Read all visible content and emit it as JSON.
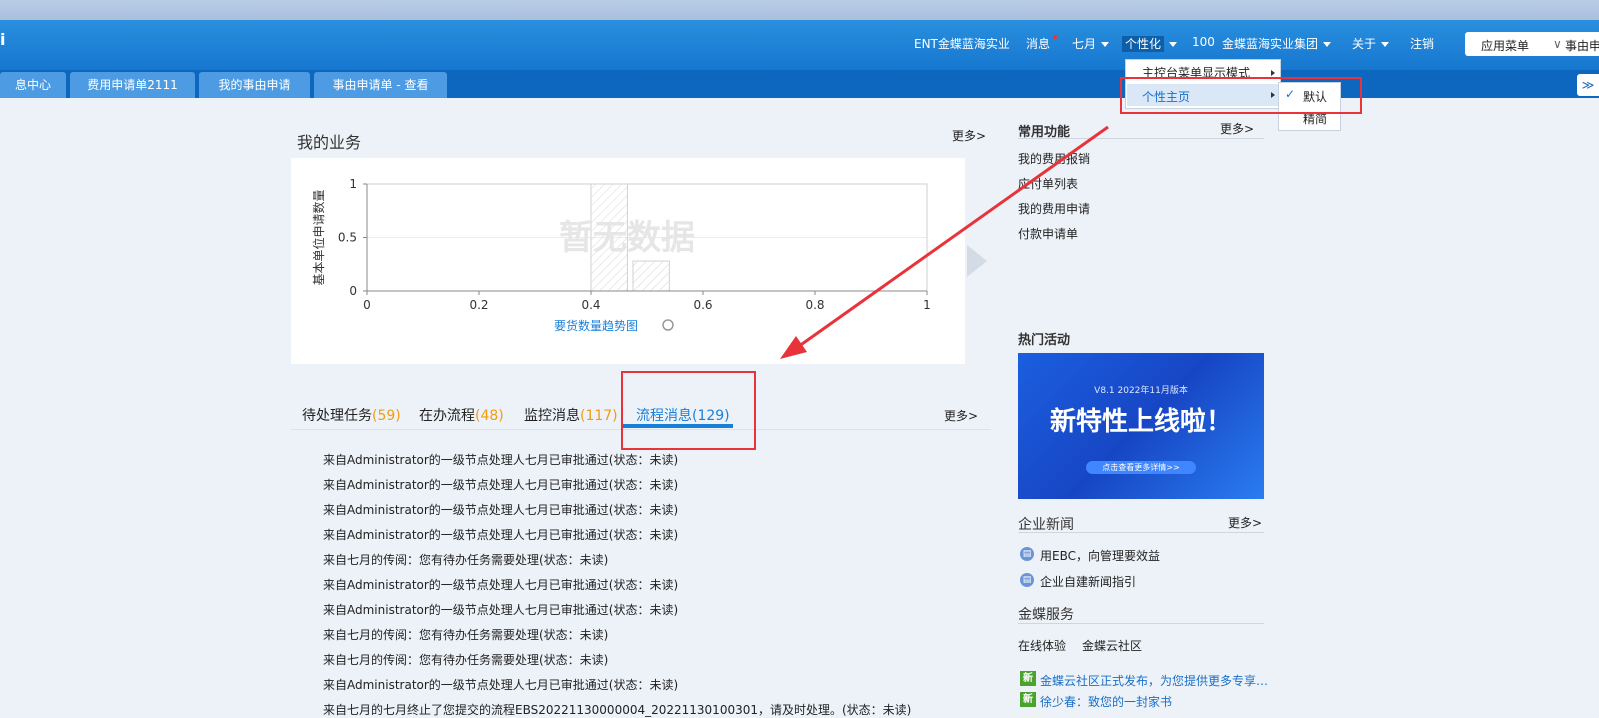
{
  "header": {
    "org": "ENT金蝶蓝海实业",
    "messages": "消息",
    "user": "七月",
    "personalize": "个性化",
    "count": "100",
    "group": "金蝶蓝海实业集团",
    "about": "关于",
    "logout": "注销",
    "app_menu": "应用菜单",
    "reason_truncated": "事由申",
    "logo_glyph": "i"
  },
  "tabs": [
    {
      "label": "息中心"
    },
    {
      "label": "费用申请单2111"
    },
    {
      "label": "我的事由申请"
    },
    {
      "label": "事由申请单 - 查看"
    }
  ],
  "dropdown": {
    "item1": "主控台菜单显示模式",
    "item2": "个性主页",
    "sub_default": "默认",
    "sub_simple": "精简",
    "check": "✓"
  },
  "business": {
    "title": "我的业务",
    "more": "更多>",
    "no_data": "暂无数据",
    "chart_caption": "要货数量趋势图"
  },
  "chart_data": {
    "type": "bar",
    "title": "要货数量趋势图",
    "xlabel": "",
    "ylabel": "基本单位申请数量",
    "x_ticks": [
      "0",
      "0.2",
      "0.4",
      "0.6",
      "0.8",
      "1"
    ],
    "y_ticks": [
      "0",
      "0.5",
      "1"
    ],
    "xlim": [
      0,
      1
    ],
    "ylim": [
      0,
      1
    ],
    "series": [
      {
        "values": []
      }
    ],
    "placeholder_bars": [
      {
        "x_start": 0.4,
        "x_end": 0.465,
        "height": 1
      },
      {
        "x_start": 0.475,
        "x_end": 0.54,
        "height": 0.28
      }
    ]
  },
  "list_tabs": [
    {
      "label": "待处理任务",
      "count": "(59)"
    },
    {
      "label": "在办流程",
      "count": "(48)"
    },
    {
      "label": "监控消息",
      "count": "(117)"
    },
    {
      "label": "流程消息",
      "count": "(129)"
    }
  ],
  "list_more": "更多>",
  "messages": [
    "来自Administrator的一级节点处理人七月已审批通过(状态：未读)",
    "来自Administrator的一级节点处理人七月已审批通过(状态：未读)",
    "来自Administrator的一级节点处理人七月已审批通过(状态：未读)",
    "来自Administrator的一级节点处理人七月已审批通过(状态：未读)",
    "来自七月的传阅：您有待办任务需要处理(状态：未读)",
    "来自Administrator的一级节点处理人七月已审批通过(状态：未读)",
    "来自Administrator的一级节点处理人七月已审批通过(状态：未读)",
    "来自七月的传阅：您有待办任务需要处理(状态：未读)",
    "来自七月的传阅：您有待办任务需要处理(状态：未读)",
    "来自Administrator的一级节点处理人七月已审批通过(状态：未读)",
    "来自七月的七月终止了您提交的流程EBS20221130000004_20221130100301，请及时处理。(状态：未读)"
  ],
  "common": {
    "title": "常用功能",
    "more": "更多>",
    "items": [
      "我的费用报销",
      "应付单列表",
      "我的费用申请",
      "付款申请单"
    ]
  },
  "hot": {
    "title": "热门活动",
    "banner_version": "V8.1 2022年11月版本",
    "banner_headline": "新特性上线啦！",
    "banner_cta": "点击查看更多详情>>"
  },
  "news": {
    "title": "企业新闻",
    "more": "更多>",
    "items": [
      "用EBC，向管理要效益",
      "企业自建新闻指引"
    ]
  },
  "service": {
    "title": "金蝶服务",
    "links": [
      "在线体验",
      "金蝶云社区"
    ],
    "new_badge": "新",
    "announcements": [
      "金蝶云社区正式发布，为您提供更多专享…",
      "徐少春：致您的一封家书"
    ]
  }
}
